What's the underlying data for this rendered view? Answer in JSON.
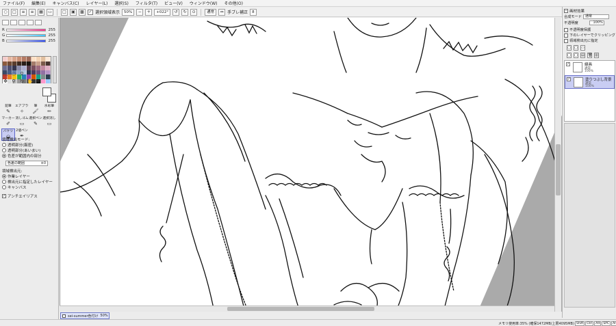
{
  "menu": {
    "items": [
      "ファイル(F)",
      "編集(E)",
      "キャンバス(C)",
      "レイヤー(L)",
      "選択(S)",
      "フィルタ(T)",
      "ビュー(V)",
      "ウィンドウ(W)",
      "その他(O)"
    ]
  },
  "toolbar": {
    "show_selection_label": "選択領域表示",
    "show_selection_checked": true,
    "zoom": "50%",
    "rotation": "+022°",
    "blend_mode": "通常",
    "stabilizer_label": "手ブレ補正",
    "stabilizer_value": "8"
  },
  "color_panel": {
    "r_label": "R",
    "r_value": "255",
    "g_label": "G",
    "g_value": "255",
    "b_label": "B",
    "b_value": "255",
    "gradient_r": "#ff2d8f",
    "gradient_g": "#3ec5ff",
    "gradient_b": "#2d4dff",
    "swatches": [
      "#f4cccc",
      "#e6b8a2",
      "#d9a38a",
      "#c98f74",
      "#b57a63",
      "#9e6a58",
      "#ffe1c6",
      "#f3d2b3",
      "#e2bf9e",
      "#fbe8d8",
      "#8b5a3c",
      "#6f4a34",
      "#5a3d2d",
      "#3d2a20",
      "#2b1e18",
      "#1b1410",
      "#a47c6a",
      "#c8a08a",
      "#7a5a4a",
      "#463530",
      "#6b6b8f",
      "#4e4e6e",
      "#35354e",
      "#8c8cab",
      "#aeaed0",
      "#5a3c4a",
      "#7a4e5e",
      "#9e6a7e",
      "#c28aa0",
      "#e0b0c4",
      "#3a4a6a",
      "#4a5e86",
      "#6a80aa",
      "#8ea4c8",
      "#b4c4de",
      "#2a3450",
      "#4c3a5e",
      "#6e5080",
      "#9270a4",
      "#b694c6",
      "#c0392b",
      "#e67e22",
      "#f1c40f",
      "#27ae60",
      "#2980b9",
      "#8e44ad",
      "#d35400",
      "#16a085",
      "#7f8c8d",
      "#2c3e50",
      "#ffffff",
      "#dddddd",
      "#bbbbbb",
      "#999999",
      "#777777",
      "#555555",
      "#333333",
      "#111111",
      "#ff99cc",
      "#99ccff"
    ]
  },
  "brush_tools": [
    {
      "label": "鉛筆",
      "icon": "✎",
      "selected": false
    },
    {
      "label": "エアブラシ",
      "icon": "✧",
      "selected": false
    },
    {
      "label": "筆",
      "icon": "🖌",
      "selected": false
    },
    {
      "label": "水彩筆",
      "icon": "✏",
      "selected": false
    },
    {
      "label": "マーカー",
      "icon": "✐",
      "selected": false
    },
    {
      "label": "消しゴム",
      "icon": "▭",
      "selected": false
    },
    {
      "label": "選択ペン",
      "icon": "✎",
      "selected": false
    },
    {
      "label": "選択消し",
      "icon": "▭",
      "selected": false
    },
    {
      "label": "バケツ",
      "icon": "◒",
      "selected": true
    },
    {
      "label": "2値ペン",
      "icon": "✒",
      "selected": false
    },
    {
      "label": "",
      "icon": "",
      "selected": false
    },
    {
      "label": "",
      "icon": "",
      "selected": false
    }
  ],
  "fill_options": {
    "target_mode_label": "領域検出モード:",
    "modes": [
      {
        "label": "透明部分(厳密)",
        "on": false
      },
      {
        "label": "透明部分(あいまい)",
        "on": false
      },
      {
        "label": "色差が範囲内の部分",
        "on": true
      }
    ],
    "color_range_label": "色差の範囲",
    "color_range_value": "±0",
    "source_label": "領域検出元:",
    "sources": [
      {
        "label": "作業レイヤー",
        "on": true
      },
      {
        "label": "検出元に指定したレイヤー",
        "on": false
      },
      {
        "label": "キャンバス",
        "on": false
      }
    ],
    "antialias_label": "アンチエイリアス",
    "antialias_checked": true
  },
  "layer_panel": {
    "title": "画材効果",
    "blend_label": "合成モード",
    "blend_value": "通常",
    "opacity_label": "不透明度",
    "opacity_value": "100%",
    "options": [
      {
        "label": "不透明度保護",
        "checked": false
      },
      {
        "label": "下のレイヤーでクリッピング",
        "checked": false
      },
      {
        "label": "領域検出元に指定",
        "checked": false
      }
    ],
    "layers": [
      {
        "name": "線画",
        "mode": "通常",
        "opacity": "100%",
        "selected": false
      },
      {
        "name": "塗りつぶし背景",
        "mode": "通常",
        "opacity": "100%",
        "selected": true
      }
    ]
  },
  "document_tab": {
    "name": "sei-summer色付け",
    "zoom": "50%"
  },
  "status": {
    "memory": "メモリ使用率:35% (確保1472MB/上限4095MB)",
    "keys": [
      "Shift",
      "Ctrl",
      "Alt",
      "SPC",
      "Any"
    ]
  },
  "colors": {
    "selection_highlight": "#c9cdf3",
    "selection_border": "#5a64c8",
    "canvas_gutter": "#aaaaaa",
    "line_art": "#111111"
  }
}
